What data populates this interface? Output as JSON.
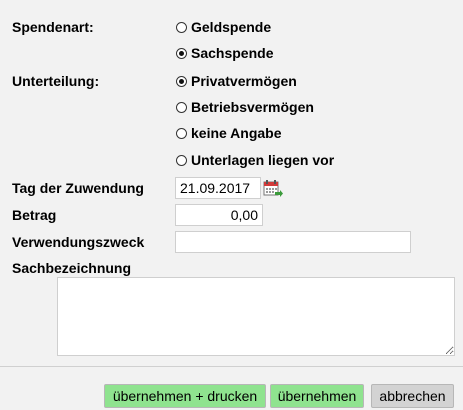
{
  "form": {
    "spendenart": {
      "label": "Spendenart:",
      "options": [
        {
          "label": "Geldspende",
          "checked": false
        },
        {
          "label": "Sachspende",
          "checked": true
        }
      ]
    },
    "unterteilung": {
      "label": "Unterteilung:",
      "options": [
        {
          "label": "Privatvermögen",
          "checked": true
        },
        {
          "label": "Betriebsvermögen",
          "checked": false
        },
        {
          "label": "keine Angabe",
          "checked": false
        },
        {
          "label": "Unterlagen liegen vor",
          "checked": false
        }
      ]
    },
    "tag_der_zuwendung": {
      "label": "Tag der Zuwendung",
      "value": "21.09.2017"
    },
    "betrag": {
      "label": "Betrag",
      "value": "0,00"
    },
    "verwendungszweck": {
      "label": "Verwendungszweck",
      "value": ""
    },
    "sachbezeichnung": {
      "label": "Sachbezeichnung",
      "value": ""
    }
  },
  "icons": {
    "calendar": "calendar-icon"
  },
  "buttons": {
    "accept_print": "übernehmen + drucken",
    "accept": "übernehmen",
    "cancel": "abbrechen"
  },
  "colors": {
    "button_green": "#8fe38f",
    "button_gray": "#d3d3d3",
    "background": "#f2f2f2"
  }
}
